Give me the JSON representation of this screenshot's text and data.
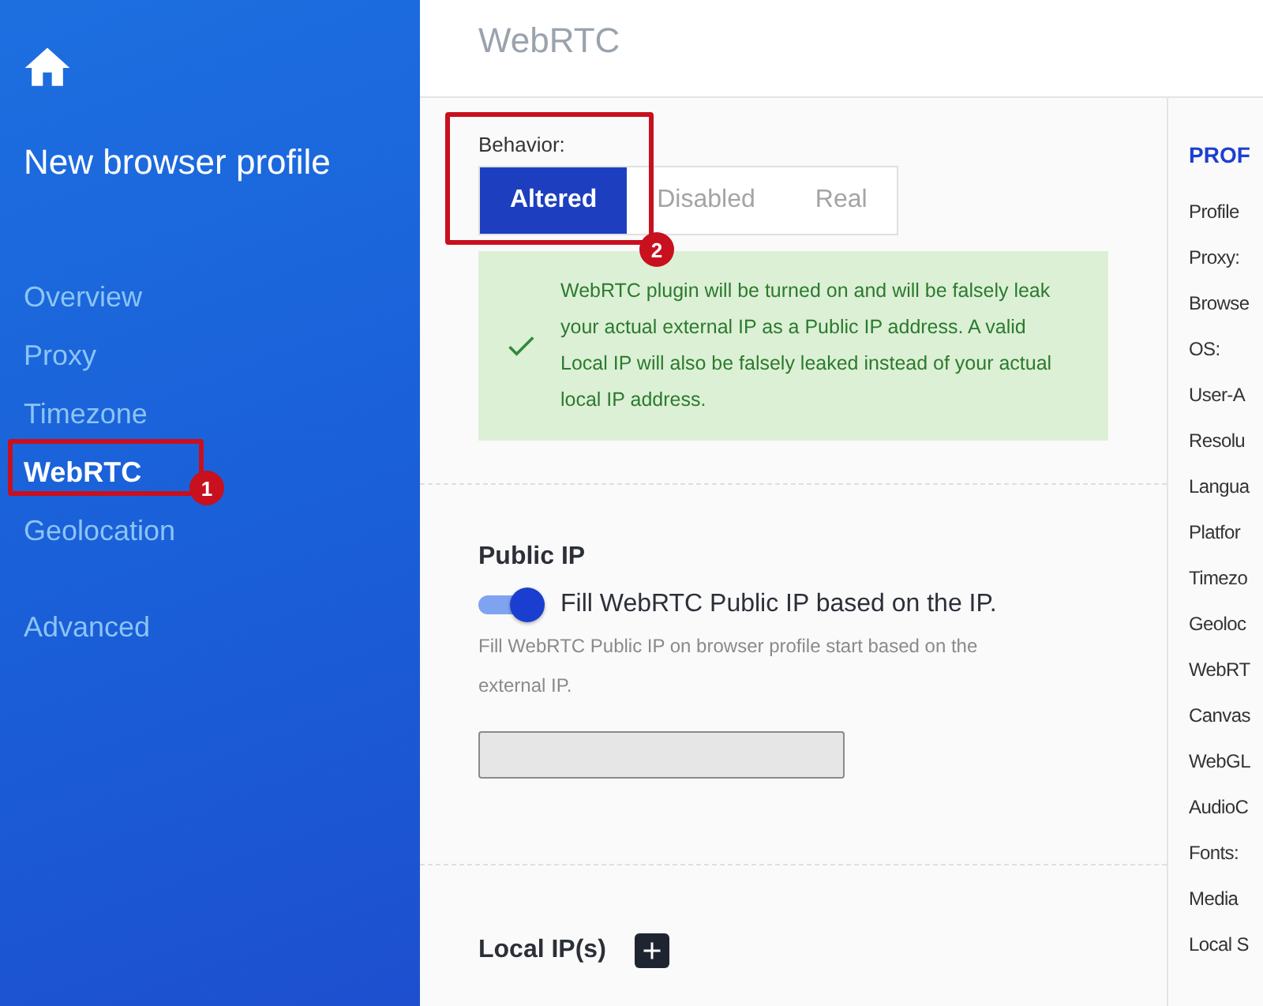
{
  "sidebar": {
    "title": "New browser profile",
    "nav": [
      {
        "label": "Overview",
        "selected": false
      },
      {
        "label": "Proxy",
        "selected": false
      },
      {
        "label": "Timezone",
        "selected": false
      },
      {
        "label": "WebRTC",
        "selected": true,
        "callout": "1"
      },
      {
        "label": "Geolocation",
        "selected": false
      }
    ],
    "extra_nav": [
      {
        "label": "Advanced",
        "selected": false
      }
    ]
  },
  "page_title": "WebRTC",
  "behavior": {
    "label": "Behavior:",
    "callout": "2",
    "options": [
      {
        "label": "Altered",
        "selected": true
      },
      {
        "label": "Disabled",
        "selected": false
      },
      {
        "label": "Real",
        "selected": false
      }
    ],
    "notice": "WebRTC plugin will be turned on and will be falsely leak your actual external IP as a Public IP address. A valid Local IP will also be falsely leaked instead of your actual local IP address."
  },
  "public_ip": {
    "heading": "Public IP",
    "toggle": {
      "label": "Fill WebRTC Public IP based on the IP.",
      "on": true
    },
    "help": "Fill WebRTC Public IP on browser profile start based on the external IP.",
    "input": {
      "disabled": true
    }
  },
  "local_ip": {
    "heading": "Local IP(s)"
  },
  "profile_panel": {
    "heading": "PROF",
    "rows": [
      "Profile",
      "Proxy:",
      "Browse",
      "OS:",
      "User-A",
      "Resolu",
      "Langua",
      "Platfor",
      "Timezo",
      "Geoloc",
      "WebRT",
      "Canvas",
      "WebGL",
      "AudioC",
      "Fonts:",
      "Media",
      "Local S"
    ]
  }
}
